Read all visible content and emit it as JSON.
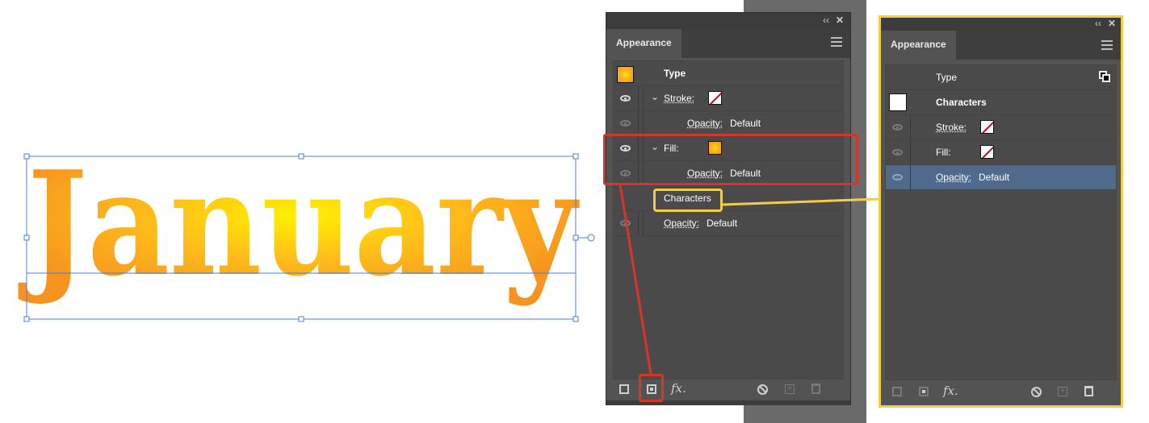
{
  "canvas": {
    "word": "January",
    "gradient": {
      "center": "#fff200",
      "edge": "#f7931e"
    }
  },
  "panel_left": {
    "title": "Appearance",
    "rows": [
      {
        "label": "Type"
      },
      {
        "label": "Stroke:"
      },
      {
        "label": "Opacity:",
        "value": "Default"
      },
      {
        "label": "Fill:"
      },
      {
        "label": "Opacity:",
        "value": "Default"
      },
      {
        "label": "Characters"
      },
      {
        "label": "Opacity:",
        "value": "Default"
      }
    ],
    "footer": {
      "fx": "fx."
    }
  },
  "panel_right": {
    "title": "Appearance",
    "rows": [
      {
        "label": "Type"
      },
      {
        "label": "Characters"
      },
      {
        "label": "Stroke:"
      },
      {
        "label": "Fill:"
      },
      {
        "label": "Opacity:",
        "value": "Default"
      }
    ],
    "footer": {
      "fx": "fx."
    }
  },
  "colors": {
    "highlight_red": "#d8352a",
    "highlight_yellow": "#f2cd4b",
    "selection_blue": "#4f6a8a"
  },
  "icons": [
    "eye-icon",
    "chevron-down-icon",
    "menu-icon",
    "collapse-icon",
    "close-icon",
    "fx-icon",
    "no-icon",
    "trash-icon",
    "new-item-icon"
  ]
}
